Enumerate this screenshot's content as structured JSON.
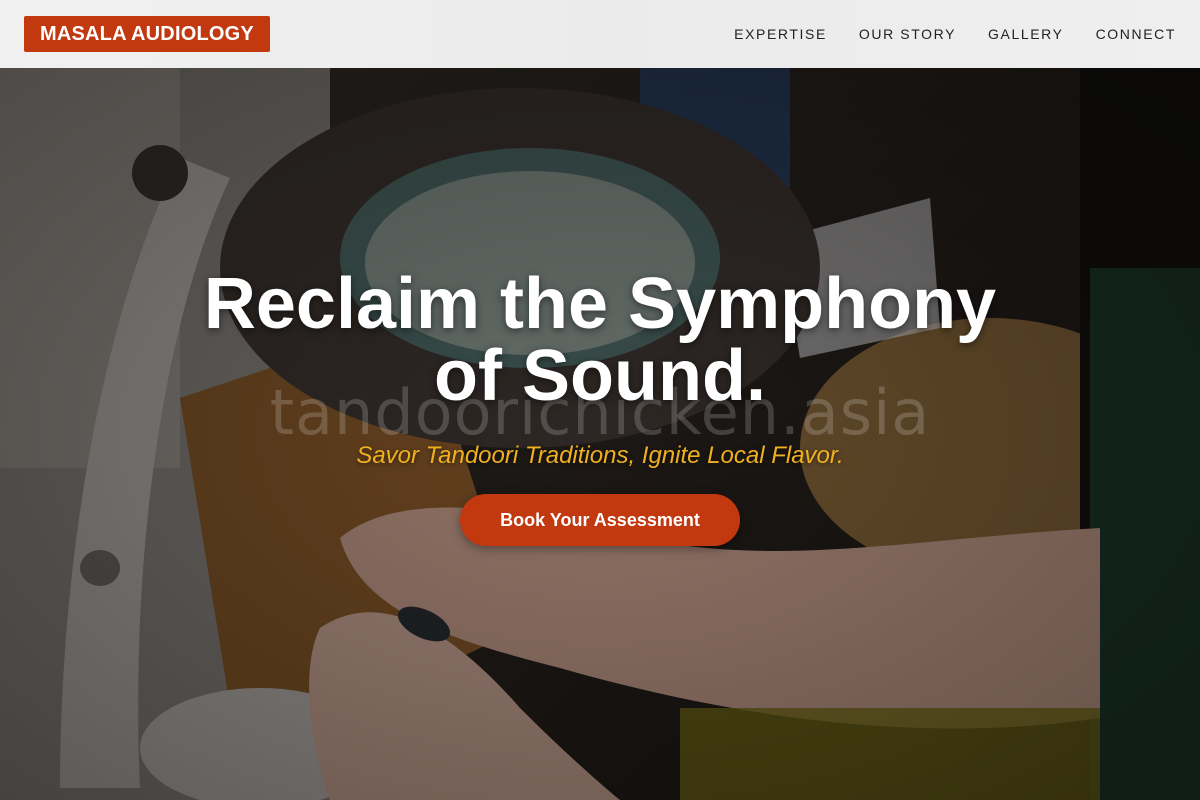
{
  "brand": {
    "logo_text": "MASALA AUDIOLOGY",
    "accent_color": "#c2380f"
  },
  "nav": {
    "items": [
      {
        "label": "EXPERTISE"
      },
      {
        "label": "OUR STORY"
      },
      {
        "label": "GALLERY"
      },
      {
        "label": "CONNECT"
      }
    ]
  },
  "hero": {
    "title": "Reclaim the Symphony of Sound.",
    "watermark": "tandoorichicken.asia",
    "tagline": "Savor Tandoori Traditions, Ignite Local Flavor.",
    "tagline_color": "#f0b020",
    "cta_label": "Book Your Assessment",
    "background_image": "audiologist-hands-repairing-hearing-aid-under-magnifier-lamp"
  }
}
